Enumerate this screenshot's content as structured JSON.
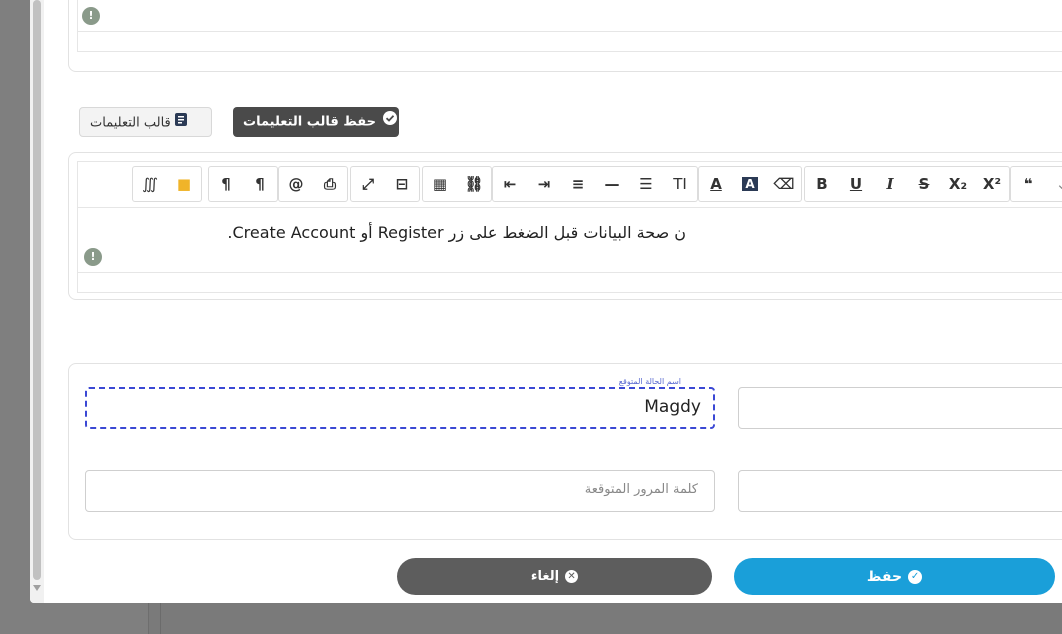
{
  "template": {
    "instructions_label": "قالب التعليمات",
    "save_instructions_label": "حفظ قالب التعليمات"
  },
  "editor": {
    "content": "ن صحة البيانات قبل الضغط على زر Register أو Create Account."
  },
  "toolbar": {
    "groups": [
      [
        "∭",
        "▮",
        "¶",
        "¶"
      ],
      [
        "@",
        "⎙",
        "⤢",
        "⊟"
      ],
      [
        "▦",
        "⛓"
      ],
      [
        "⇤",
        "⇥",
        "≡",
        "—",
        "☰",
        "TI"
      ],
      [
        "A",
        "A",
        "⌫"
      ],
      [
        "B",
        "U",
        "I",
        "S",
        "X₂",
        "X²"
      ],
      [
        "❝",
        "⌄"
      ]
    ]
  },
  "form": {
    "field1": {
      "label": "اسم الحالة المتوقع",
      "value": "Magdy"
    },
    "field2": {
      "placeholder": "كلمة المرور المتوقعة"
    }
  },
  "buttons": {
    "cancel": "إلغاء",
    "save": "حفظ"
  }
}
